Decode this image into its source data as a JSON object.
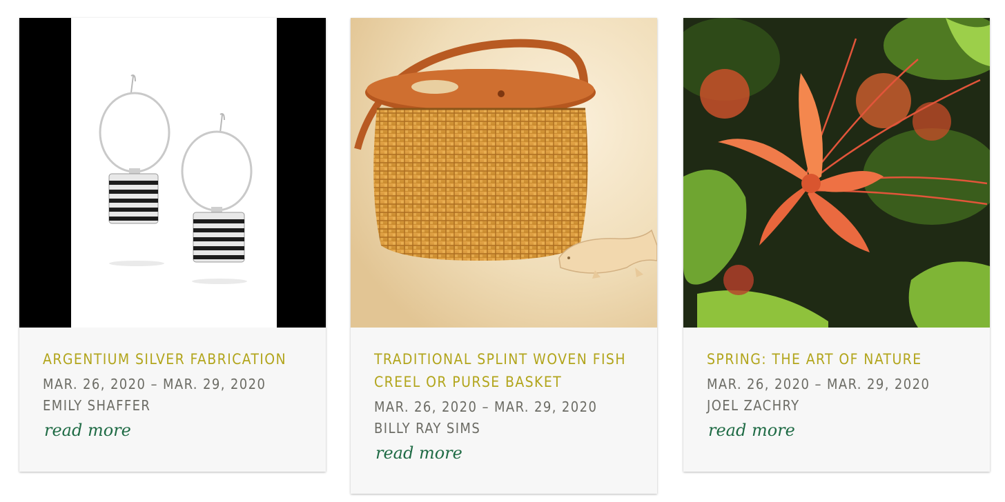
{
  "events": [
    {
      "title": "Argentium Silver Fabrication",
      "dates": "Mar. 26, 2020 – Mar. 29, 2020",
      "artist": "Emily Shaffer",
      "link_label": "read more",
      "image_icon": "earrings-photo"
    },
    {
      "title": "Traditional Splint Woven Fish Creel or Purse Basket",
      "dates": "Mar. 26, 2020 – Mar. 29, 2020",
      "artist": "Billy Ray Sims",
      "link_label": "read more",
      "image_icon": "basket-photo"
    },
    {
      "title": "Spring: The Art of Nature",
      "dates": "Mar. 26, 2020 – Mar. 29, 2020",
      "artist": "Joel Zachry",
      "link_label": "read more",
      "image_icon": "flower-photo"
    }
  ],
  "colors": {
    "title": "#b2a51c",
    "meta": "#6b6b64",
    "link": "#1f6b45",
    "card_bg": "#f7f7f7"
  }
}
